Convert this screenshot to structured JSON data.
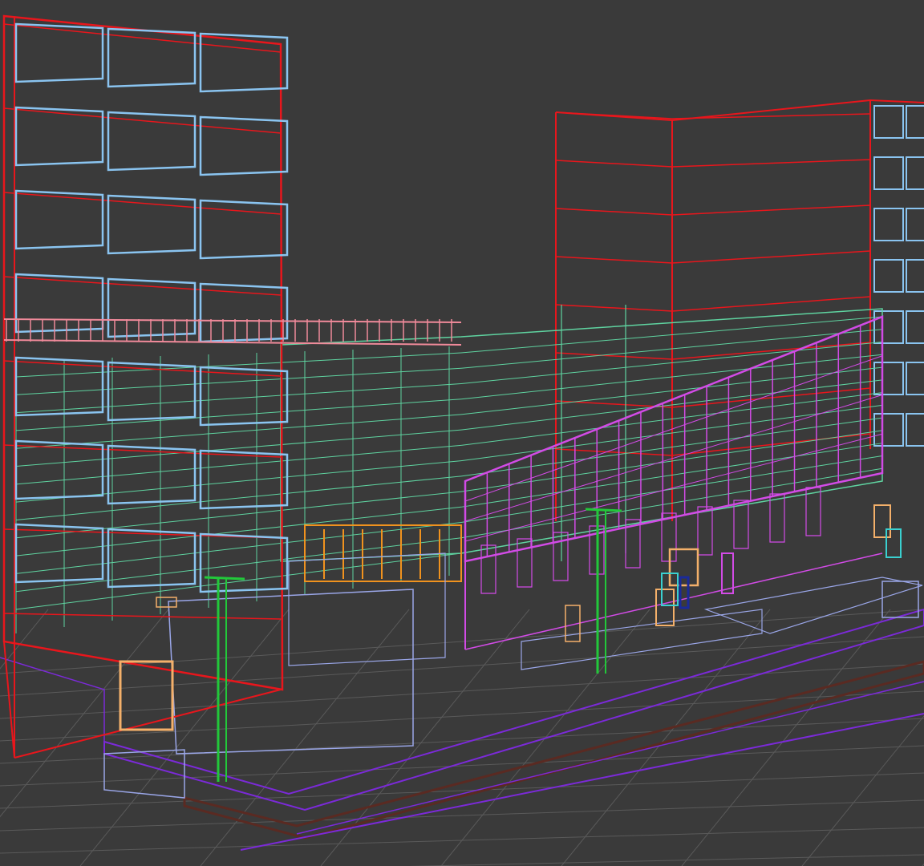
{
  "viewport": {
    "background": "#3a3a3a",
    "grid_color": "#5a5a5a"
  },
  "colors": {
    "building_red": "#e8161c",
    "window_blue": "#8ac4f0",
    "floor_green": "#5fd3a0",
    "facade_magenta": "#d24be6",
    "railing_pink": "#f08a9a",
    "window_orange": "#f0921e",
    "door_orange": "#f4b06a",
    "base_lavender": "#9aa6e8",
    "ground_purple": "#7b2ad8",
    "curb_dark": "#5a2a22",
    "pole_green": "#22c83a",
    "accent_cyan": "#3ad0d0",
    "accent_navy": "#1a2a9a"
  }
}
